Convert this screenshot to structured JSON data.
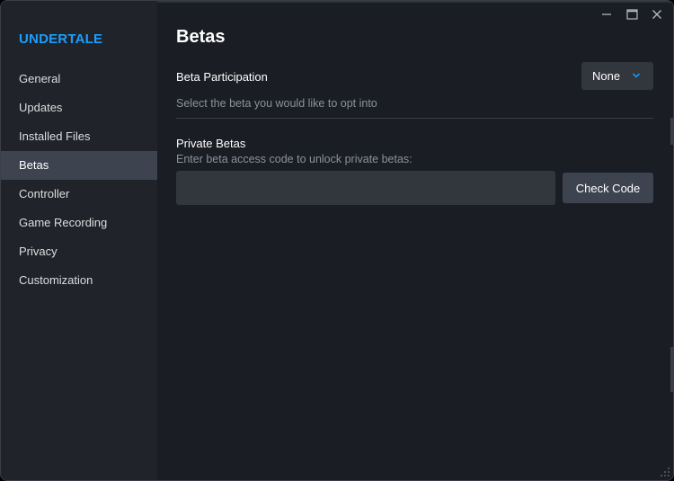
{
  "sidebar": {
    "game_title": "UNDERTALE",
    "items": [
      {
        "label": "General",
        "active": false
      },
      {
        "label": "Updates",
        "active": false
      },
      {
        "label": "Installed Files",
        "active": false
      },
      {
        "label": "Betas",
        "active": true
      },
      {
        "label": "Controller",
        "active": false
      },
      {
        "label": "Game Recording",
        "active": false
      },
      {
        "label": "Privacy",
        "active": false
      },
      {
        "label": "Customization",
        "active": false
      }
    ]
  },
  "window_controls": {
    "minimize_icon": "minimize-icon",
    "maximize_icon": "maximize-icon",
    "close_icon": "close-icon"
  },
  "main": {
    "title": "Betas",
    "beta_participation": {
      "label": "Beta Participation",
      "selected": "None",
      "description": "Select the beta you would like to opt into"
    },
    "private_betas": {
      "title": "Private Betas",
      "description": "Enter beta access code to unlock private betas:",
      "input_value": "",
      "input_placeholder": "",
      "button_label": "Check Code"
    }
  },
  "colors": {
    "accent": "#1a9fff",
    "background": "#1a1d24",
    "sidebar": "#202329",
    "active_item": "#3d4450",
    "muted_text": "#8b929a"
  }
}
